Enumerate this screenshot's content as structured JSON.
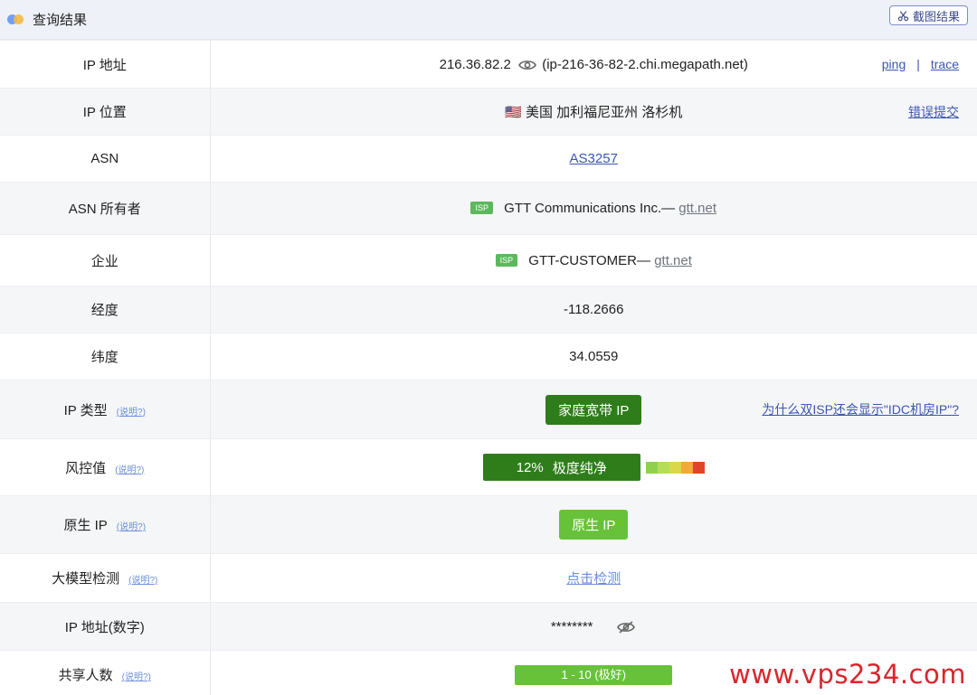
{
  "header": {
    "title": "查询结果",
    "screenshot_button": "截图结果"
  },
  "rows": {
    "ip": {
      "label": "IP 地址",
      "ip": "216.36.82.2",
      "hostname": "(ip-216-36-82-2.chi.megapath.net)",
      "ping": "ping",
      "sep": "|",
      "trace": "trace"
    },
    "location": {
      "label": "IP 位置",
      "flag": "🇺🇸",
      "value": "美国 加利福尼亚州 洛杉机",
      "report": "错误提交"
    },
    "asn": {
      "label": "ASN",
      "value": "AS3257"
    },
    "asn_owner": {
      "label": "ASN 所有者",
      "tag": "ISP",
      "name": "GTT Communications Inc.—",
      "domain": "gtt.net"
    },
    "company": {
      "label": "企业",
      "tag": "ISP",
      "name": "GTT-CUSTOMER—",
      "domain": "gtt.net"
    },
    "longitude": {
      "label": "经度",
      "value": "-118.2666"
    },
    "latitude": {
      "label": "纬度",
      "value": "34.0559"
    },
    "ip_type": {
      "label": "IP 类型",
      "explain": "(说明?)",
      "value": "家庭宽带 IP",
      "why": "为什么双ISP还会显示\"IDC机房IP\"?"
    },
    "risk": {
      "label": "风控值",
      "explain": "(说明?)",
      "percent": "12%",
      "level": "极度纯净",
      "scale_colors": [
        "#8fd14f",
        "#b5dd5a",
        "#d8d84a",
        "#f0a93a",
        "#e0442b"
      ]
    },
    "native": {
      "label": "原生 IP",
      "explain": "(说明?)",
      "value": "原生 IP"
    },
    "llm": {
      "label": "大模型检测",
      "explain": "(说明?)",
      "value": "点击检测"
    },
    "ip_numeric": {
      "label": "IP 地址(数字)",
      "value": "********"
    },
    "shared": {
      "label": "共享人数",
      "explain": "(说明?)",
      "value": "1 - 10 (极好)"
    }
  },
  "watermark": "www.vps234.com",
  "colors": {
    "accent": "#3b56b4",
    "dark_green": "#2e7d1a",
    "light_green": "#67c23a",
    "watermark_red": "#d7262c"
  }
}
